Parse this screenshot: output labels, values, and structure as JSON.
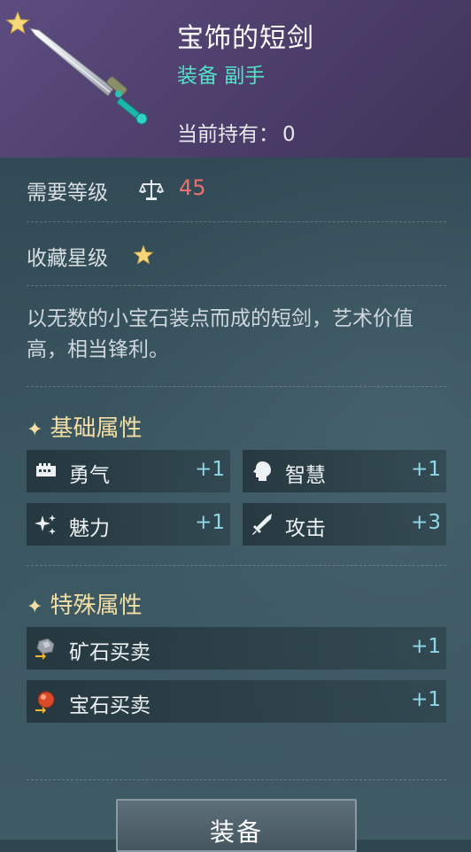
{
  "item": {
    "name": "宝饰的短剑",
    "subtitle": "装备 副手",
    "owned_label": "当前持有：",
    "owned_value": "0"
  },
  "requirement": {
    "label": "需要等级",
    "icon": "scale-icon",
    "value": "45",
    "value_color": "#ef6e6e"
  },
  "collection": {
    "label": "收藏星级",
    "stars": 1
  },
  "description": "以无数的小宝石装点而成的短剑，艺术价值高，相当锋利。",
  "basic_attrs": {
    "title": "基础属性",
    "items": [
      {
        "icon": "courage-icon",
        "label": "勇气",
        "value": "+1"
      },
      {
        "icon": "wisdom-head-icon",
        "label": "智慧",
        "value": "+1"
      },
      {
        "icon": "charm-sparkle-icon",
        "label": "魅力",
        "value": "+1"
      },
      {
        "icon": "sword-attack-icon",
        "label": "攻击",
        "value": "+3"
      }
    ]
  },
  "special_attrs": {
    "title": "特殊属性",
    "items": [
      {
        "icon": "ore-trade-icon",
        "label": "矿石买卖",
        "value": "+1"
      },
      {
        "icon": "gem-trade-icon",
        "label": "宝石买卖",
        "value": "+1"
      }
    ]
  },
  "equip_button": "装备",
  "colors": {
    "header": "#4c3d6a",
    "accent_teal": "#54e0c6",
    "section_gold": "#f3dea4",
    "stat_value": "#8fd8e8"
  }
}
